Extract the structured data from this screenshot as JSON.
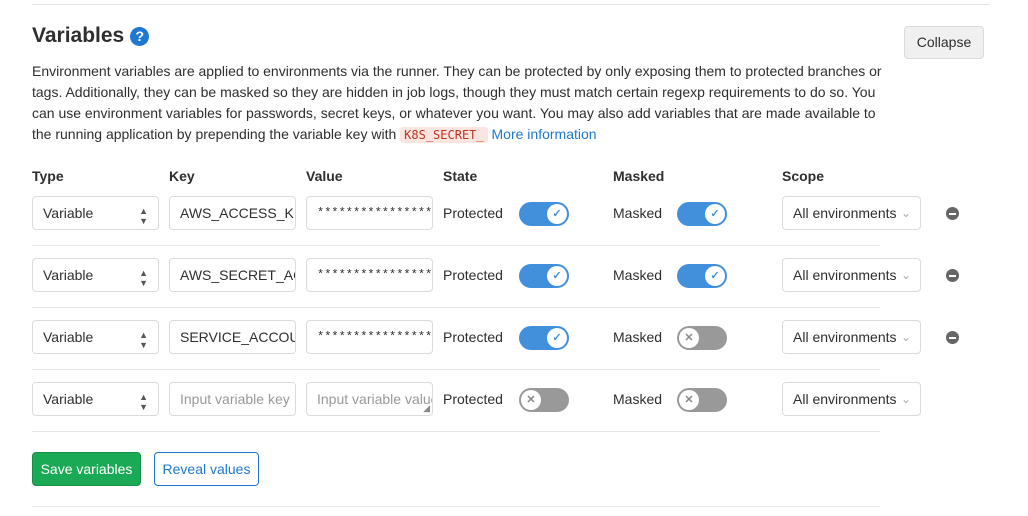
{
  "section": {
    "title": "Variables",
    "help_glyph": "?",
    "collapse_label": "Collapse",
    "desc_text": "Environment variables are applied to environments via the runner. They can be protected by only exposing them to protected branches or tags. Additionally, they can be masked so they are hidden in job logs, though they must match certain regexp requirements to do so. You can use environment variables for passwords, secret keys, or whatever you want. You may also add variables that are made available to the running application by prepending the variable key with ",
    "desc_code": "K8S_SECRET_",
    "desc_link": "More information"
  },
  "headers": {
    "type": "Type",
    "key": "Key",
    "value": "Value",
    "state": "State",
    "masked": "Masked",
    "scope": "Scope"
  },
  "rows": [
    {
      "type": "Variable",
      "key": "AWS_ACCESS_KEY_ID",
      "value": "******************",
      "state_label": "Protected",
      "protected": true,
      "masked_label": "Masked",
      "masked": true,
      "scope": "All environments"
    },
    {
      "type": "Variable",
      "key": "AWS_SECRET_ACCESS_KEY",
      "value": "******************",
      "state_label": "Protected",
      "protected": true,
      "masked_label": "Masked",
      "masked": true,
      "scope": "All environments"
    },
    {
      "type": "Variable",
      "key": "SERVICE_ACCOUNT",
      "value": "******************",
      "state_label": "Protected",
      "protected": true,
      "masked_label": "Masked",
      "masked": false,
      "scope": "All environments"
    },
    {
      "type": "Variable",
      "key_placeholder": "Input variable key",
      "value_placeholder": "Input variable value",
      "state_label": "Protected",
      "protected": false,
      "masked_label": "Masked",
      "masked": false,
      "scope": "All environments"
    }
  ],
  "actions": {
    "save_label": "Save variables",
    "reveal_label": "Reveal values"
  },
  "colors": {
    "toggle_on": "#428fdc",
    "toggle_off": "#999999",
    "save_green": "#1aaa55",
    "link_blue": "#1f78d1"
  }
}
